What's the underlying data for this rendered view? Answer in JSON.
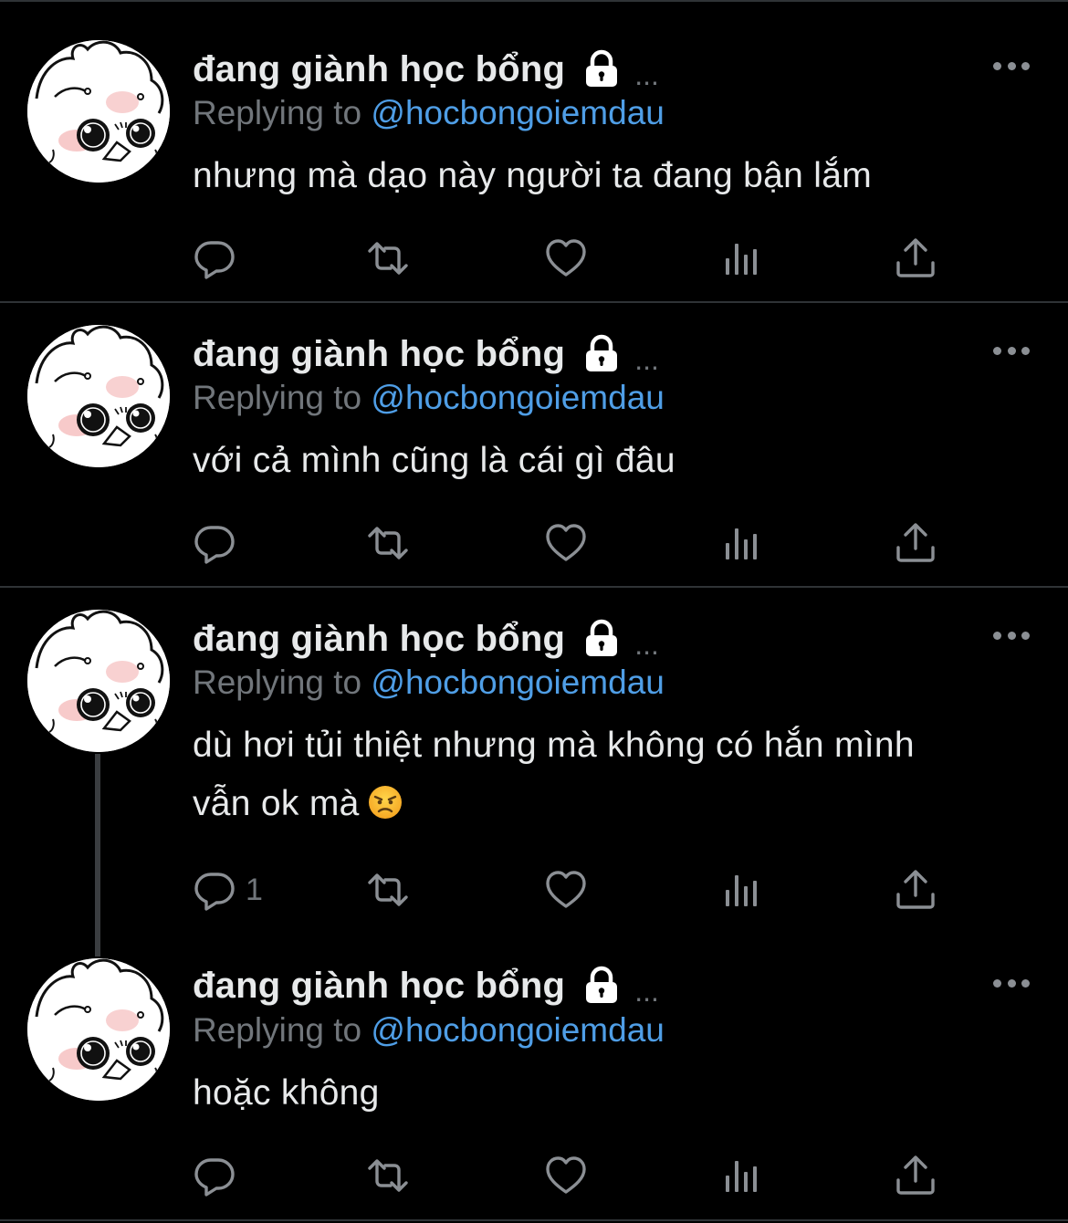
{
  "tweets": [
    {
      "author": "đang giành học bổng",
      "dots": "...",
      "replying_prefix": "Replying to",
      "reply_handle": "@hocbongoiemdau",
      "text_lines": [
        "nhưng mà dạo này người ta đang bận lắm"
      ],
      "reply_count": ""
    },
    {
      "author": "đang giành học bổng",
      "dots": "...",
      "replying_prefix": "Replying to",
      "reply_handle": "@hocbongoiemdau",
      "text_lines": [
        "với cả mình cũng là cái gì đâu"
      ],
      "reply_count": ""
    },
    {
      "author": "đang giành học bổng",
      "dots": "...",
      "replying_prefix": "Replying to",
      "reply_handle": "@hocbongoiemdau",
      "text_lines": [
        "dù hơi tủi thiệt nhưng mà không có hắn mình",
        "vẫn ok mà"
      ],
      "reply_count": "1"
    },
    {
      "author": "đang giành học bổng",
      "dots": "...",
      "replying_prefix": "Replying to",
      "reply_handle": "@hocbongoiemdau",
      "text_lines": [
        "hoặc không"
      ],
      "reply_count": ""
    }
  ],
  "icons": {
    "reply": "reply-icon",
    "retweet": "retweet-icon",
    "like": "heart-icon",
    "views": "views-icon",
    "share": "share-icon",
    "lock": "lock-icon",
    "more": "more-icon",
    "emoji": "angry-face-emoji"
  },
  "colors": {
    "background": "#000000",
    "text": "#e7e9ea",
    "muted": "#71767b",
    "link": "#4f9ee6",
    "divider": "#2f3336"
  }
}
